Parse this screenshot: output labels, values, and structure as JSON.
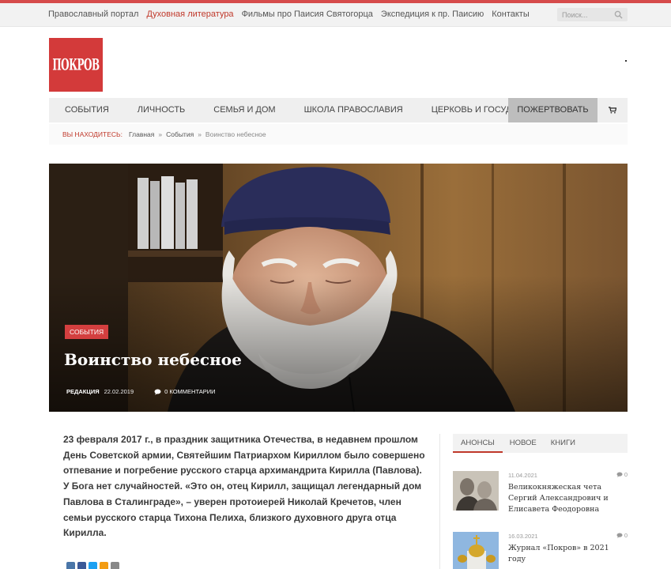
{
  "topbar": {
    "links": [
      "Православный портал",
      "Духовная литература",
      "Фильмы про Паисия Святогорца",
      "Экспедиция к пр. Паисию",
      "Контакты"
    ],
    "active_index": 1,
    "search_placeholder": "Поиск..."
  },
  "logo": {
    "text": "ПОКРОВ"
  },
  "nav": {
    "items": [
      "СОБЫТИЯ",
      "ЛИЧНОСТЬ",
      "СЕМЬЯ И ДОМ",
      "ШКОЛА ПРАВОСЛАВИЯ",
      "ЦЕРКОВЬ И ГОСУДАРСТВО"
    ],
    "donate": "ПОЖЕРТВОВАТЬ",
    "cart_icon": "cart-icon"
  },
  "breadcrumb": {
    "label": "ВЫ НАХОДИТЕСЬ:",
    "home": "Главная",
    "section": "События",
    "current": "Воинство небесное",
    "separator": "»"
  },
  "article": {
    "category": "СОБЫТИЯ",
    "title": "Воинство небесное",
    "author": "РЕДАКЦИЯ",
    "date": "22.02.2019",
    "comments": "0 КОММЕНТАРИИ",
    "lead": "23 февраля 2017 г., в праздник защитника Отечества, в недавнем прошлом День Советской армии, Святейшим Патриархом Кириллом было совершено отпевание и погребение русского старца архимандрита Кирилла (Павлова). У Бога нет случайностей. «Это он, отец Кирилл, защищал легендарный дом Павлова в Сталинграде», – уверен протоиерей Николай Кречетов, член семьи русского старца Тихона Пелиха, близкого духовного друга отца Кирилла."
  },
  "sidebar": {
    "tabs": [
      "АНОНСЫ",
      "НОВОЕ",
      "КНИГИ"
    ],
    "active_tab": 0,
    "posts": [
      {
        "date": "11.04.2021",
        "comments": "0",
        "title": "Великокняжеская чета Сергий Александрович и Елисавета Феодоровна"
      },
      {
        "date": "16.03.2021",
        "comments": "0",
        "title": "Журнал «Покров» в 2021 году"
      }
    ]
  },
  "colors": {
    "accent": "#c0392b",
    "logo_bg": "#d33a3a",
    "donate_bg": "#bdbdbd",
    "nav_bg": "#efefef"
  }
}
